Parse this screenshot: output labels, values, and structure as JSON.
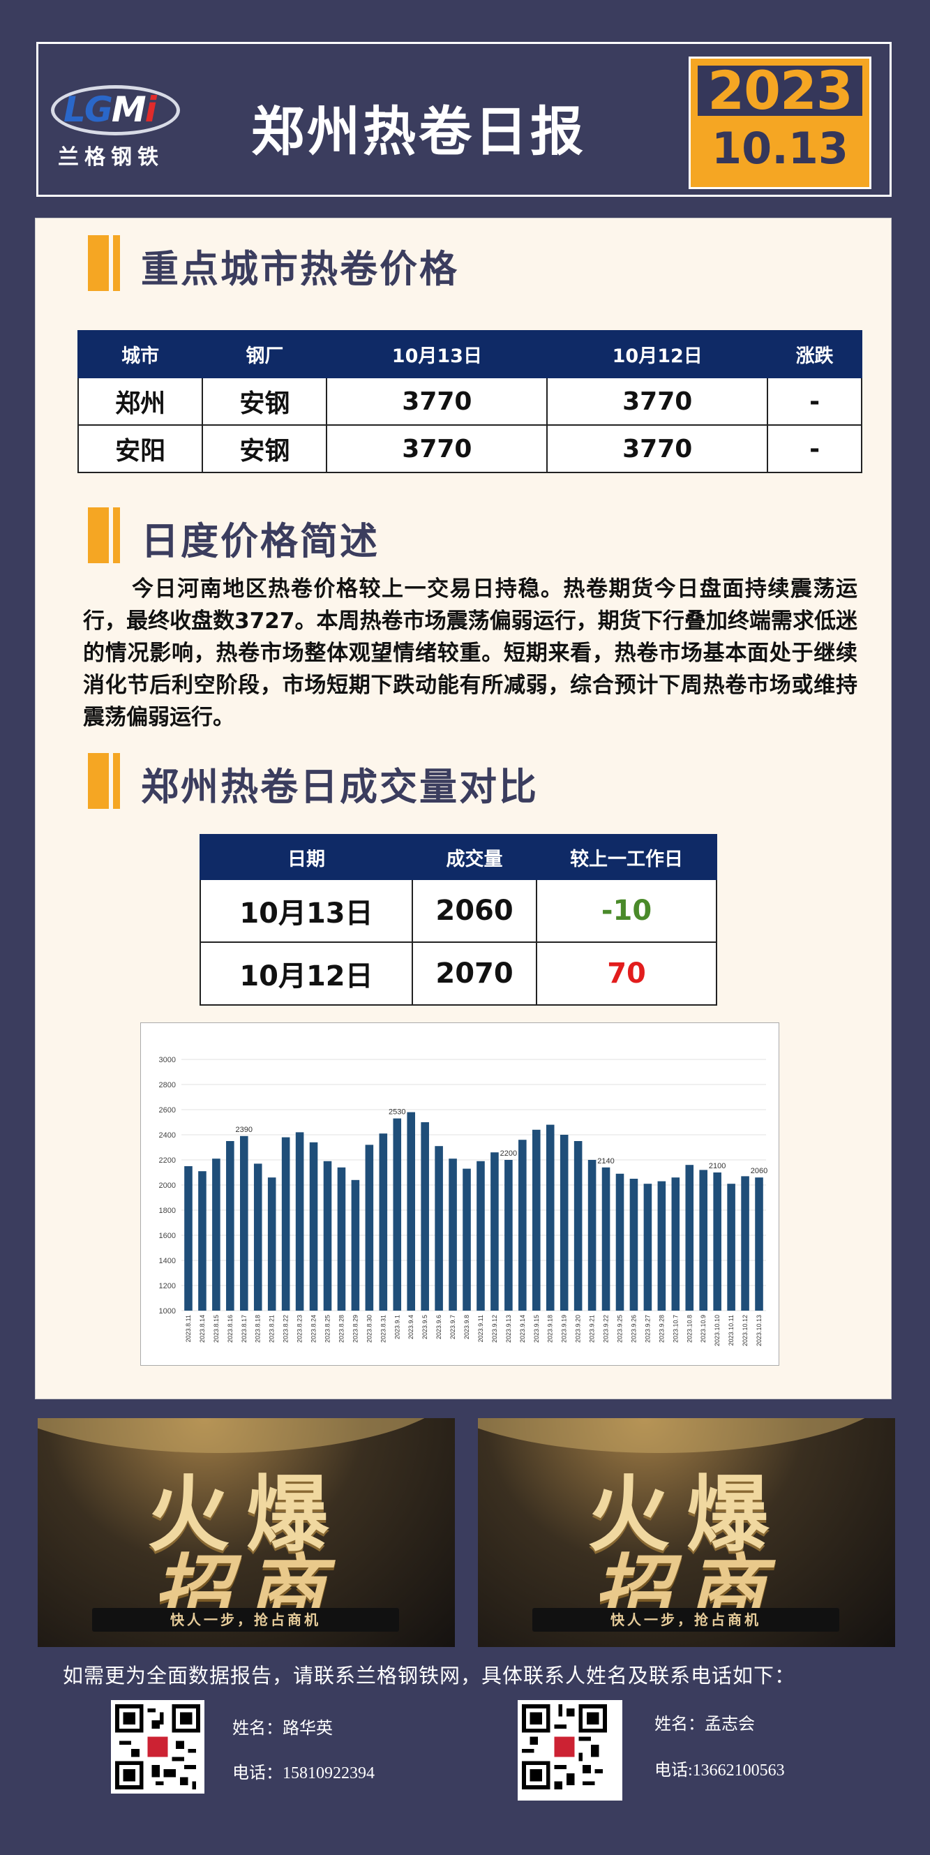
{
  "header": {
    "logo_letters": "LGMi",
    "logo_cn": "兰格钢铁",
    "title": "郑州热卷日报",
    "year": "2023",
    "date": "10.13"
  },
  "price_section": {
    "title": "重点城市热卷价格",
    "columns": [
      "城市",
      "钢厂",
      "10月13日",
      "10月12日",
      "涨跌"
    ],
    "rows": [
      [
        "郑州",
        "安钢",
        "3770",
        "3770",
        "-"
      ],
      [
        "安阳",
        "安钢",
        "3770",
        "3770",
        "-"
      ]
    ]
  },
  "summary_section": {
    "title": "日度价格简述",
    "text": "今日河南地区热卷价格较上一交易日持稳。热卷期货今日盘面持续震荡运行，最终收盘数3727。本周热卷市场震荡偏弱运行，期货下行叠加终端需求低迷的情况影响，热卷市场整体观望情绪较重。短期来看，热卷市场基本面处于继续消化节后利空阶段，市场短期下跌动能有所减弱，综合预计下周热卷市场或维持震荡偏弱运行。"
  },
  "volume_section": {
    "title": "郑州热卷日成交量对比",
    "columns": [
      "日期",
      "成交量",
      "较上一工作日"
    ],
    "rows": [
      [
        "10月13日",
        "2060",
        "-10"
      ],
      [
        "10月12日",
        "2070",
        "70"
      ]
    ],
    "colors": {
      "negative": "#4a8a2a",
      "positive": "#e21d1d"
    }
  },
  "chart_data": {
    "type": "bar",
    "categories": [
      "2023.8.11",
      "2023.8.14",
      "2023.8.15",
      "2023.8.16",
      "2023.8.17",
      "2023.8.18",
      "2023.8.21",
      "2023.8.22",
      "2023.8.23",
      "2023.8.24",
      "2023.8.25",
      "2023.8.28",
      "2023.8.29",
      "2023.8.30",
      "2023.8.31",
      "2023.9.1",
      "2023.9.4",
      "2023.9.5",
      "2023.9.6",
      "2023.9.7",
      "2023.9.8",
      "2023.9.11",
      "2023.9.12",
      "2023.9.13",
      "2023.9.14",
      "2023.9.15",
      "2023.9.18",
      "2023.9.19",
      "2023.9.20",
      "2023.9.21",
      "2023.9.22",
      "2023.9.25",
      "2023.9.26",
      "2023.9.27",
      "2023.9.28",
      "2023.10.7",
      "2023.10.8",
      "2023.10.9",
      "2023.10.10",
      "2023.10.11",
      "2023.10.12",
      "2023.10.13"
    ],
    "values": [
      2150,
      2110,
      2210,
      2350,
      2390,
      2170,
      2060,
      2380,
      2420,
      2340,
      2190,
      2140,
      2040,
      2320,
      2410,
      2530,
      2580,
      2500,
      2310,
      2210,
      2130,
      2190,
      2260,
      2200,
      2360,
      2440,
      2480,
      2400,
      2350,
      2200,
      2140,
      2090,
      2050,
      2010,
      2030,
      2060,
      2160,
      2120,
      2100,
      2010,
      2070,
      2060
    ],
    "data_labels": {
      "4": "2390",
      "15": "2530",
      "23": "2200",
      "30": "2140",
      "38": "2100",
      "41": "2060"
    },
    "ylim": [
      1000,
      3000
    ],
    "yticks": [
      "1000",
      "1200",
      "1400",
      "1600",
      "1800",
      "2000",
      "2200",
      "2400",
      "2600",
      "2800",
      "3000"
    ],
    "grid": true,
    "bar_color": "#1f4e79",
    "title": "",
    "xlabel": "",
    "ylabel": ""
  },
  "ads": [
    {
      "line1": "火爆",
      "line2": "招商",
      "slogan": "快人一步，抢占商机"
    },
    {
      "line1": "火爆",
      "line2": "招商",
      "slogan": "快人一步，抢占商机"
    }
  ],
  "footer": {
    "note": "如需更为全面数据报告，请联系兰格钢铁网，具体联系人姓名及联系电话如下：",
    "contacts": [
      {
        "name": "姓名：路华英",
        "phone": "电话：15810922394"
      },
      {
        "name": "姓名：孟志会",
        "phone": "电话:13662100563"
      }
    ]
  },
  "colors": {
    "accent": "#f5a623",
    "navy": "#0f2a66",
    "background": "#3b3d5e"
  }
}
